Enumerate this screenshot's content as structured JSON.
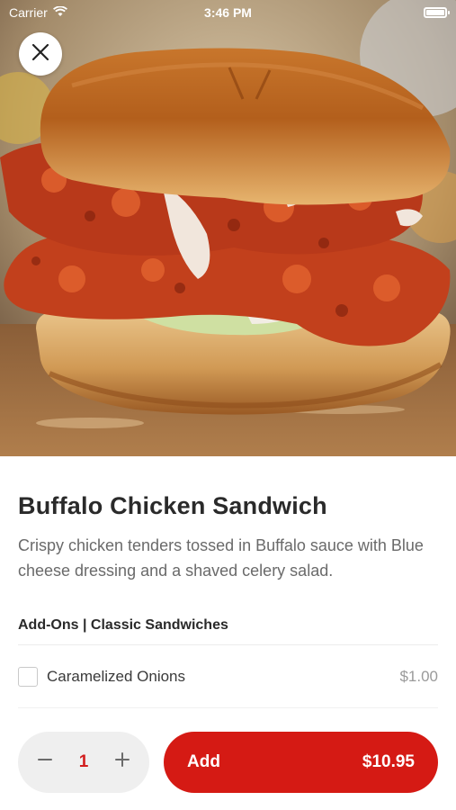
{
  "status_bar": {
    "carrier": "Carrier",
    "time": "3:46 PM"
  },
  "hero": {
    "icon": "food-photo"
  },
  "item": {
    "name": "Buffalo Chicken Sandwich",
    "description": "Crispy chicken tenders tossed in Buffalo sauce with Blue cheese dressing and a shaved celery salad."
  },
  "addons": {
    "section_title": "Add-Ons | Classic Sandwiches",
    "items": [
      {
        "label": "Caramelized Onions",
        "price": "$1.00",
        "checked": false
      }
    ]
  },
  "order": {
    "quantity": "1",
    "add_label": "Add",
    "total": "$10.95",
    "accent_color": "#d51a14"
  }
}
